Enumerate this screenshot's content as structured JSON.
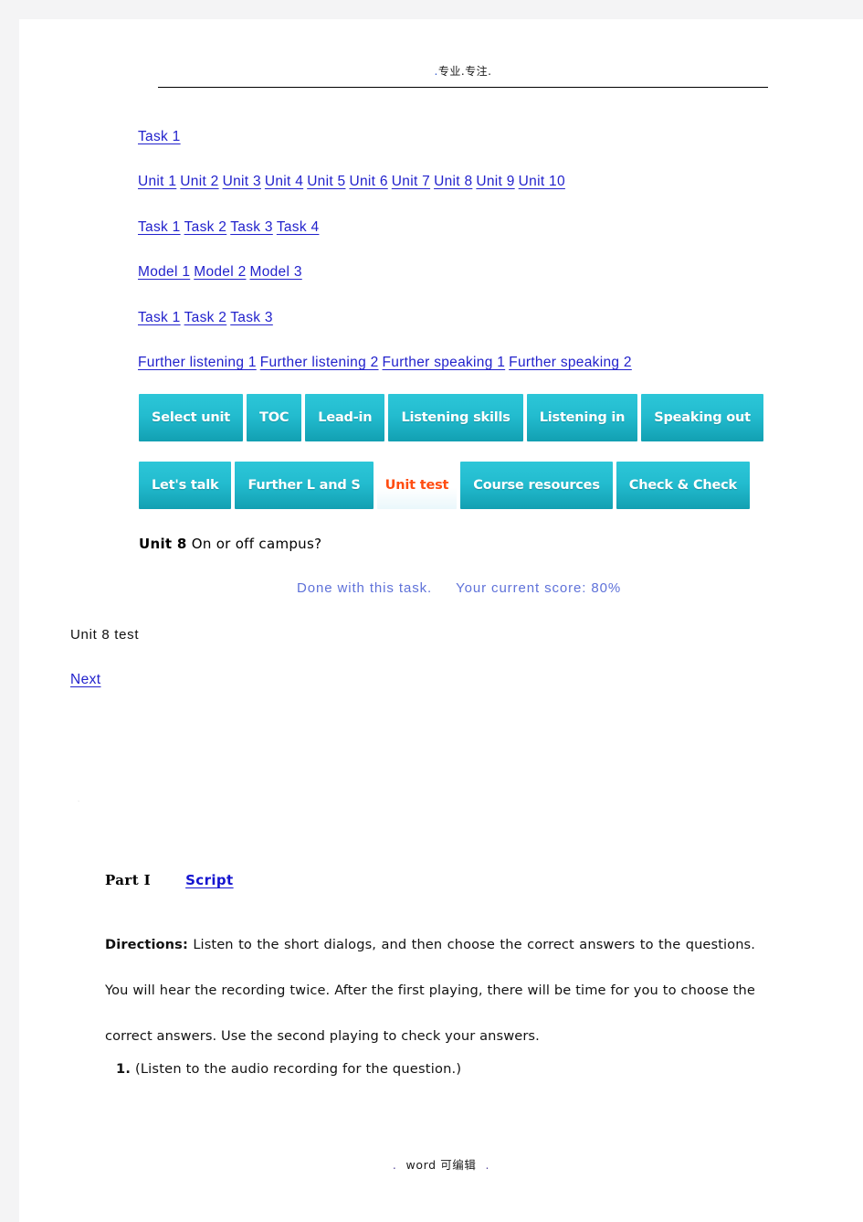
{
  "page": {
    "header_text": "专业.专注.",
    "header_lead_dot": ".",
    "header_trail_dot": "."
  },
  "nav": {
    "row_task_top": [
      {
        "label": "Task 1"
      }
    ],
    "row_units": [
      {
        "label": "Unit 1"
      },
      {
        "label": "Unit 2"
      },
      {
        "label": "Unit 3"
      },
      {
        "label": "Unit 4"
      },
      {
        "label": "Unit 5"
      },
      {
        "label": "Unit 6"
      },
      {
        "label": "Unit 7"
      },
      {
        "label": "Unit 8"
      },
      {
        "label": "Unit 9"
      },
      {
        "label": "Unit 10"
      }
    ],
    "row_tasks_four": [
      {
        "label": "Task 1"
      },
      {
        "label": "Task 2"
      },
      {
        "label": "Task 3"
      },
      {
        "label": "Task 4"
      }
    ],
    "row_models": [
      {
        "label": "Model 1"
      },
      {
        "label": "Model 2"
      },
      {
        "label": "Model 3"
      }
    ],
    "row_tasks_three": [
      {
        "label": "Task 1"
      },
      {
        "label": "Task 2"
      },
      {
        "label": "Task 3"
      }
    ],
    "row_further": [
      {
        "label": "Further listening 1"
      },
      {
        "label": "Further listening 2"
      },
      {
        "label": "Further speaking 1"
      },
      {
        "label": "Further speaking 2"
      }
    ]
  },
  "tabs": {
    "row1": [
      {
        "label": "Select unit",
        "active": false
      },
      {
        "label": "TOC",
        "active": false
      },
      {
        "label": "Lead-in",
        "active": false
      },
      {
        "label": "Listening skills",
        "active": false
      },
      {
        "label": "Listening in",
        "active": false
      },
      {
        "label": "Speaking out",
        "active": false
      }
    ],
    "row2": [
      {
        "label": "Let's talk",
        "active": false
      },
      {
        "label": "Further L and S",
        "active": false
      },
      {
        "label": "Unit test",
        "active": true
      },
      {
        "label": "Course resources",
        "active": false
      },
      {
        "label": "Check & Check",
        "active": false
      }
    ],
    "colors": {
      "tab_teal_top": "#2cc6d8",
      "tab_teal_bottom": "#12a0b2",
      "tab_text": "#ffffff",
      "active_tab_bg": "#ffffff",
      "active_tab_text": "#ff4d12"
    }
  },
  "unit": {
    "number_label": "Unit 8",
    "title": " On or off campus?"
  },
  "status": {
    "done_text": "Done with this task.",
    "score_text": "Your current score: 80%",
    "score_value": "80%",
    "color": "#5f72d9"
  },
  "test": {
    "label": "Unit 8 test",
    "next_label": "Next"
  },
  "stray": {
    "dot": "."
  },
  "part": {
    "heading": "Part I",
    "script_link": "Script",
    "directions_label": "Directions:",
    "directions_body": " Listen to the short dialogs, and then choose the correct answers to the questions. You will hear the recording twice. After the first playing, there will be time for you to choose the correct answers. Use the second playing to check your answers.",
    "question_number": "1.",
    "question_text": " (Listen to the audio recording for the question.)"
  },
  "footer": {
    "left_dot": ".",
    "text": "word 可编辑",
    "right_dot": "."
  }
}
